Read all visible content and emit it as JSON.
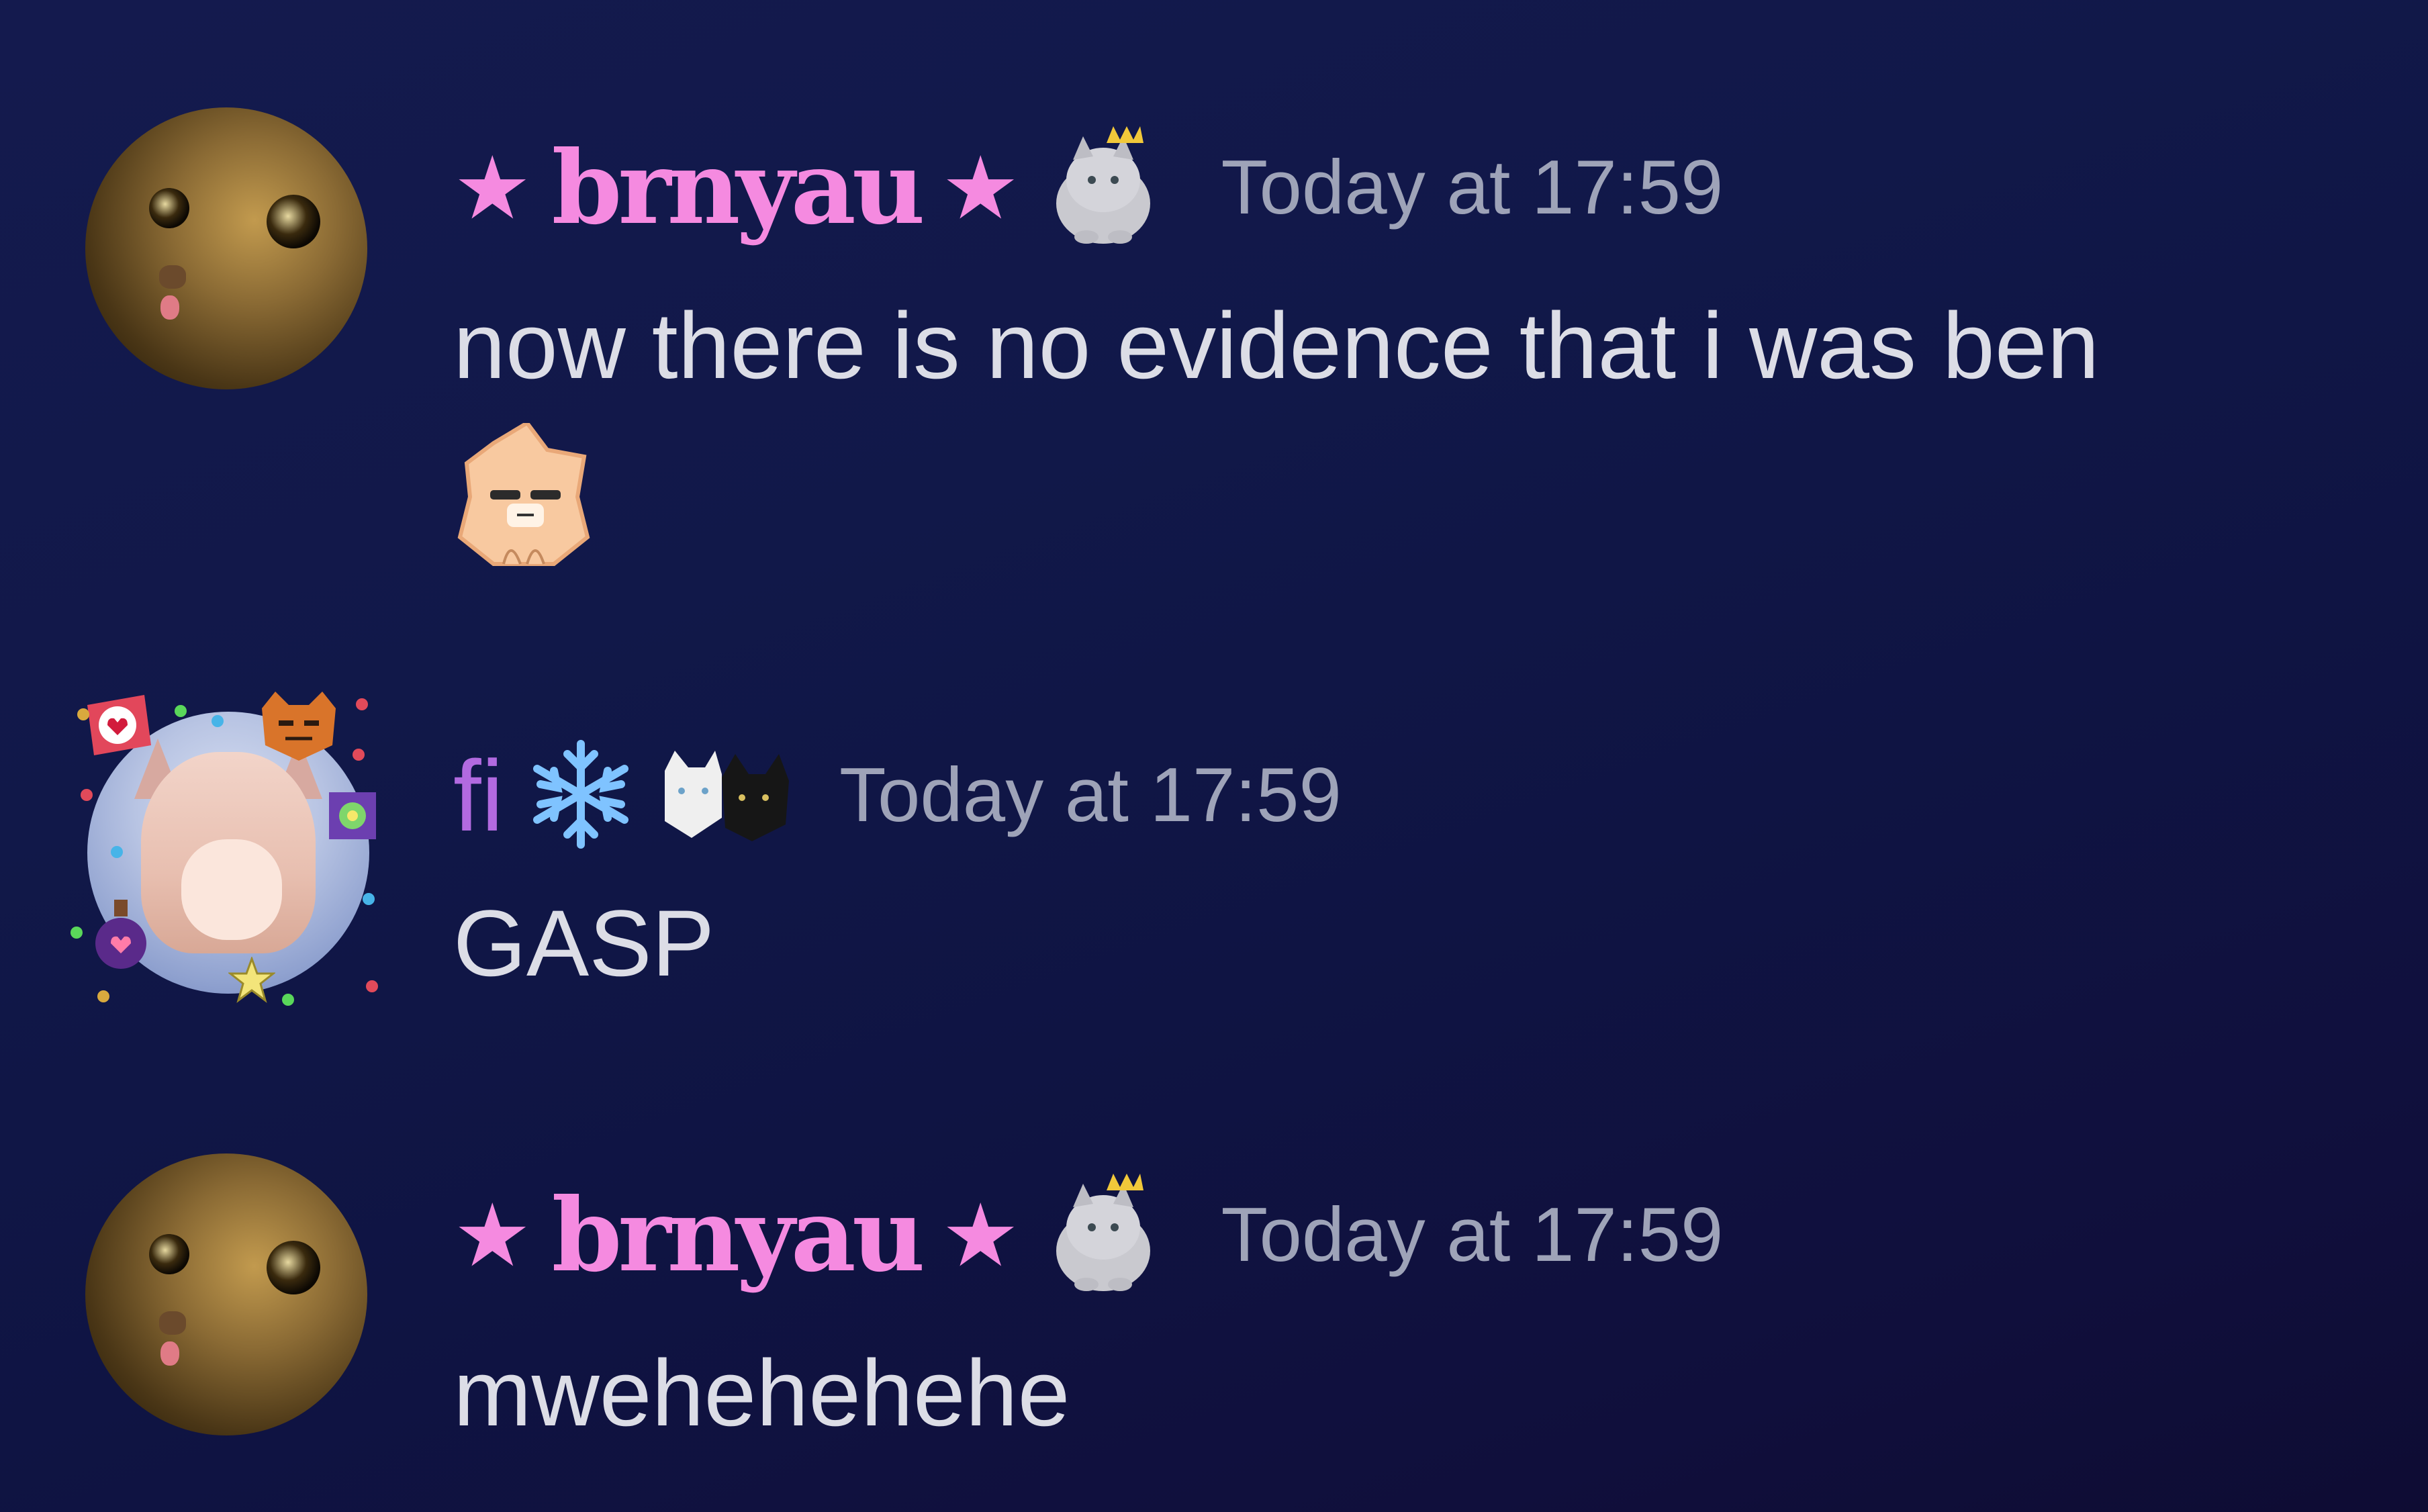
{
  "messages": [
    {
      "username": "brnyau",
      "name_decoration": "★",
      "username_color": "#f58ae0",
      "badge_icon": "cat-with-crown-icon",
      "timestamp": "Today at 17:59",
      "text": "now there is no evidence that i was ben",
      "emoji": "cat-face-emoji"
    },
    {
      "username": "fi",
      "username_color": "#b26ae0",
      "badge_icon": "snowflake-icon",
      "badge_icon_2": "two-cats-icon",
      "timestamp": "Today at 17:59",
      "text": "GASP"
    },
    {
      "username": "brnyau",
      "name_decoration": "★",
      "username_color": "#f58ae0",
      "badge_icon": "cat-with-crown-icon",
      "timestamp": "Today at 17:59",
      "text": "mwehehehehe"
    }
  ],
  "colors": {
    "background": "#111849",
    "text": "#dcdde6",
    "timestamp": "#9ea3b8"
  }
}
